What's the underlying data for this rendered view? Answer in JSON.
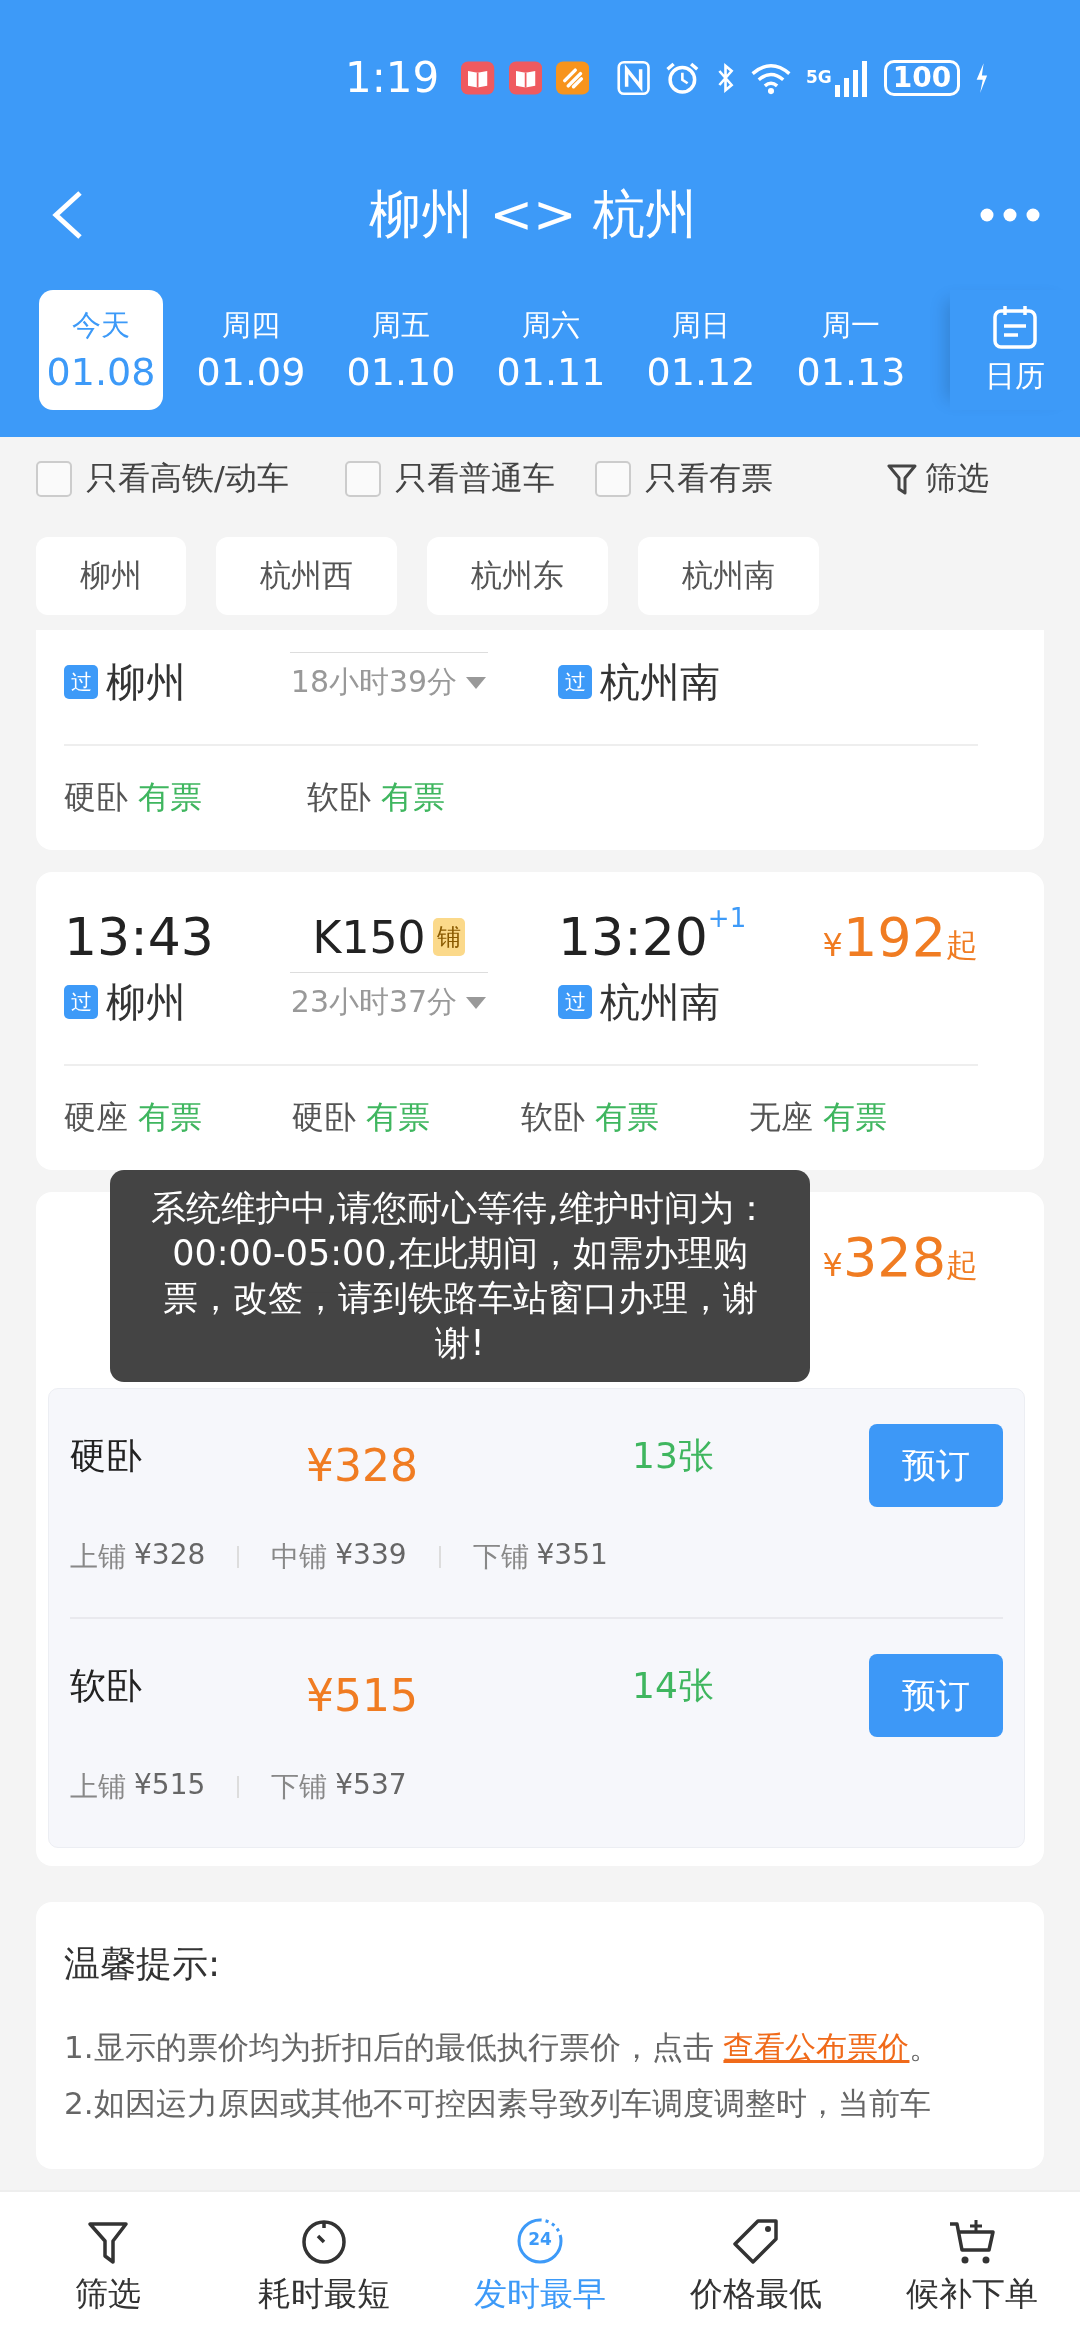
{
  "status_bar": {
    "time": "1:19",
    "network": "5G",
    "battery": "100"
  },
  "header": {
    "title": "柳州 <> 杭州"
  },
  "dates": [
    {
      "weekday": "今天",
      "date": "01.08",
      "selected": true
    },
    {
      "weekday": "周四",
      "date": "01.09",
      "selected": false
    },
    {
      "weekday": "周五",
      "date": "01.10",
      "selected": false
    },
    {
      "weekday": "周六",
      "date": "01.11",
      "selected": false
    },
    {
      "weekday": "周日",
      "date": "01.12",
      "selected": false
    },
    {
      "weekday": "周一",
      "date": "01.13",
      "selected": false
    }
  ],
  "calendar": {
    "label": "日历"
  },
  "filters": [
    {
      "label": "只看高铁/动车",
      "checked": false
    },
    {
      "label": "只看普通车",
      "checked": false
    },
    {
      "label": "只看有票",
      "checked": false
    }
  ],
  "filter_button": {
    "label": "筛选"
  },
  "stations": [
    {
      "label": "柳州"
    },
    {
      "label": "杭州西"
    },
    {
      "label": "杭州东"
    },
    {
      "label": "杭州南"
    }
  ],
  "trains": [
    {
      "depart_tag": "过",
      "depart_station": "柳州",
      "duration": "18小时39分",
      "arrive_tag": "过",
      "arrive_station": "杭州南",
      "expanded": false,
      "seats": [
        {
          "name": "硬卧",
          "status": "有票"
        },
        {
          "name": "软卧",
          "status": "有票"
        }
      ]
    },
    {
      "depart_time": "13:43",
      "depart_tag": "过",
      "depart_station": "柳州",
      "train_no": "K150",
      "badge": "铺",
      "duration": "23小时37分",
      "arrive_time": "13:20",
      "next_day": "+1",
      "arrive_tag": "过",
      "arrive_station": "杭州南",
      "price": {
        "currency": "¥",
        "amount": "192",
        "suffix": "起"
      },
      "expanded": false,
      "seats": [
        {
          "name": "硬座",
          "status": "有票"
        },
        {
          "name": "硬卧",
          "status": "有票"
        },
        {
          "name": "软卧",
          "status": "有票"
        },
        {
          "name": "无座",
          "status": "有票"
        }
      ]
    },
    {
      "price": {
        "currency": "¥",
        "amount": "328",
        "suffix": "起"
      },
      "expanded": true,
      "seat_details": [
        {
          "name": "硬卧",
          "price": "¥328",
          "count": "13张",
          "button": "预订",
          "berths": [
            {
              "label": "上铺",
              "price": "¥328"
            },
            {
              "label": "中铺",
              "price": "¥339"
            },
            {
              "label": "下铺",
              "price": "¥351"
            }
          ]
        },
        {
          "name": "软卧",
          "price": "¥515",
          "count": "14张",
          "button": "预订",
          "berths": [
            {
              "label": "上铺",
              "price": "¥515"
            },
            {
              "label": "下铺",
              "price": "¥537"
            }
          ]
        }
      ]
    }
  ],
  "notice": {
    "title": "温馨提示:",
    "items": [
      {
        "text": "1.显示的票价均为折扣后的最低执行票价，点击 ",
        "link": "查看公布票价",
        "after": "。"
      },
      {
        "text": "2.如因运力原因或其他不可控因素导致列车调度调整时，当前车"
      }
    ]
  },
  "toast": {
    "text": "系统维护中,请您耐心等待,维护时间为：00:00-05:00,在此期间，如需办理购票，改签，请到铁路车站窗口办理，谢谢!"
  },
  "nav": [
    {
      "kind": "filter",
      "label": "筛选",
      "selected": false
    },
    {
      "kind": "timer",
      "label": "耗时最短",
      "selected": false
    },
    {
      "kind": "clock24",
      "icon_text": "24",
      "label": "发时最早",
      "selected": true
    },
    {
      "kind": "tag",
      "label": "价格最低",
      "selected": false
    },
    {
      "kind": "cart",
      "label": "候补下单",
      "selected": false
    }
  ]
}
